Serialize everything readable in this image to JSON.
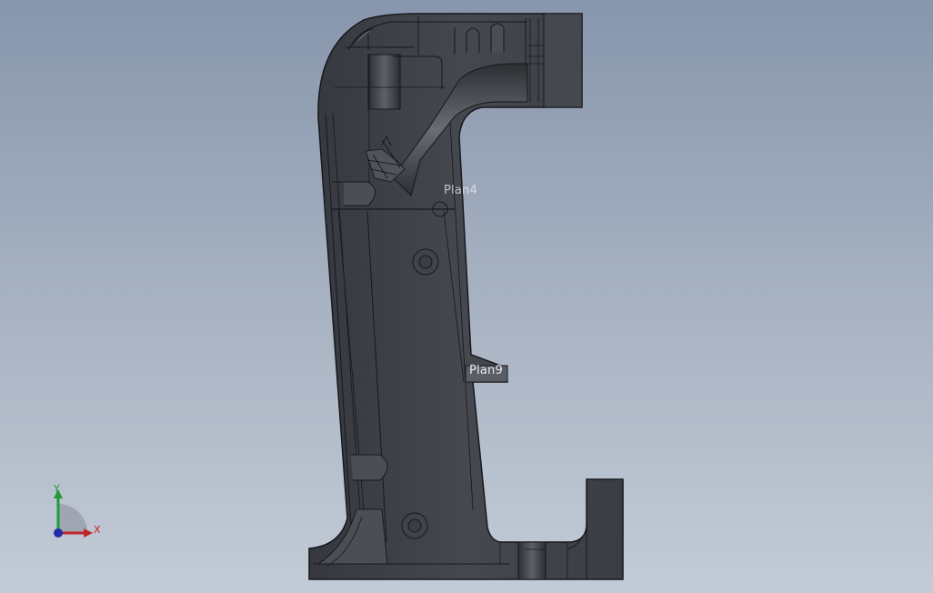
{
  "viewport": {
    "background_top": "#8796ac",
    "background_bottom": "#c3cbd6",
    "part_color": "#3f4249",
    "part_edge_color": "#16181c"
  },
  "planes": {
    "plane_top_label": "Plan4",
    "plane_mid_label": "Plan9"
  },
  "triad": {
    "x_label": "X",
    "y_label": "Y",
    "x_color": "#c0262b",
    "y_color": "#1f9a36",
    "z_color": "#1d2ea8"
  }
}
